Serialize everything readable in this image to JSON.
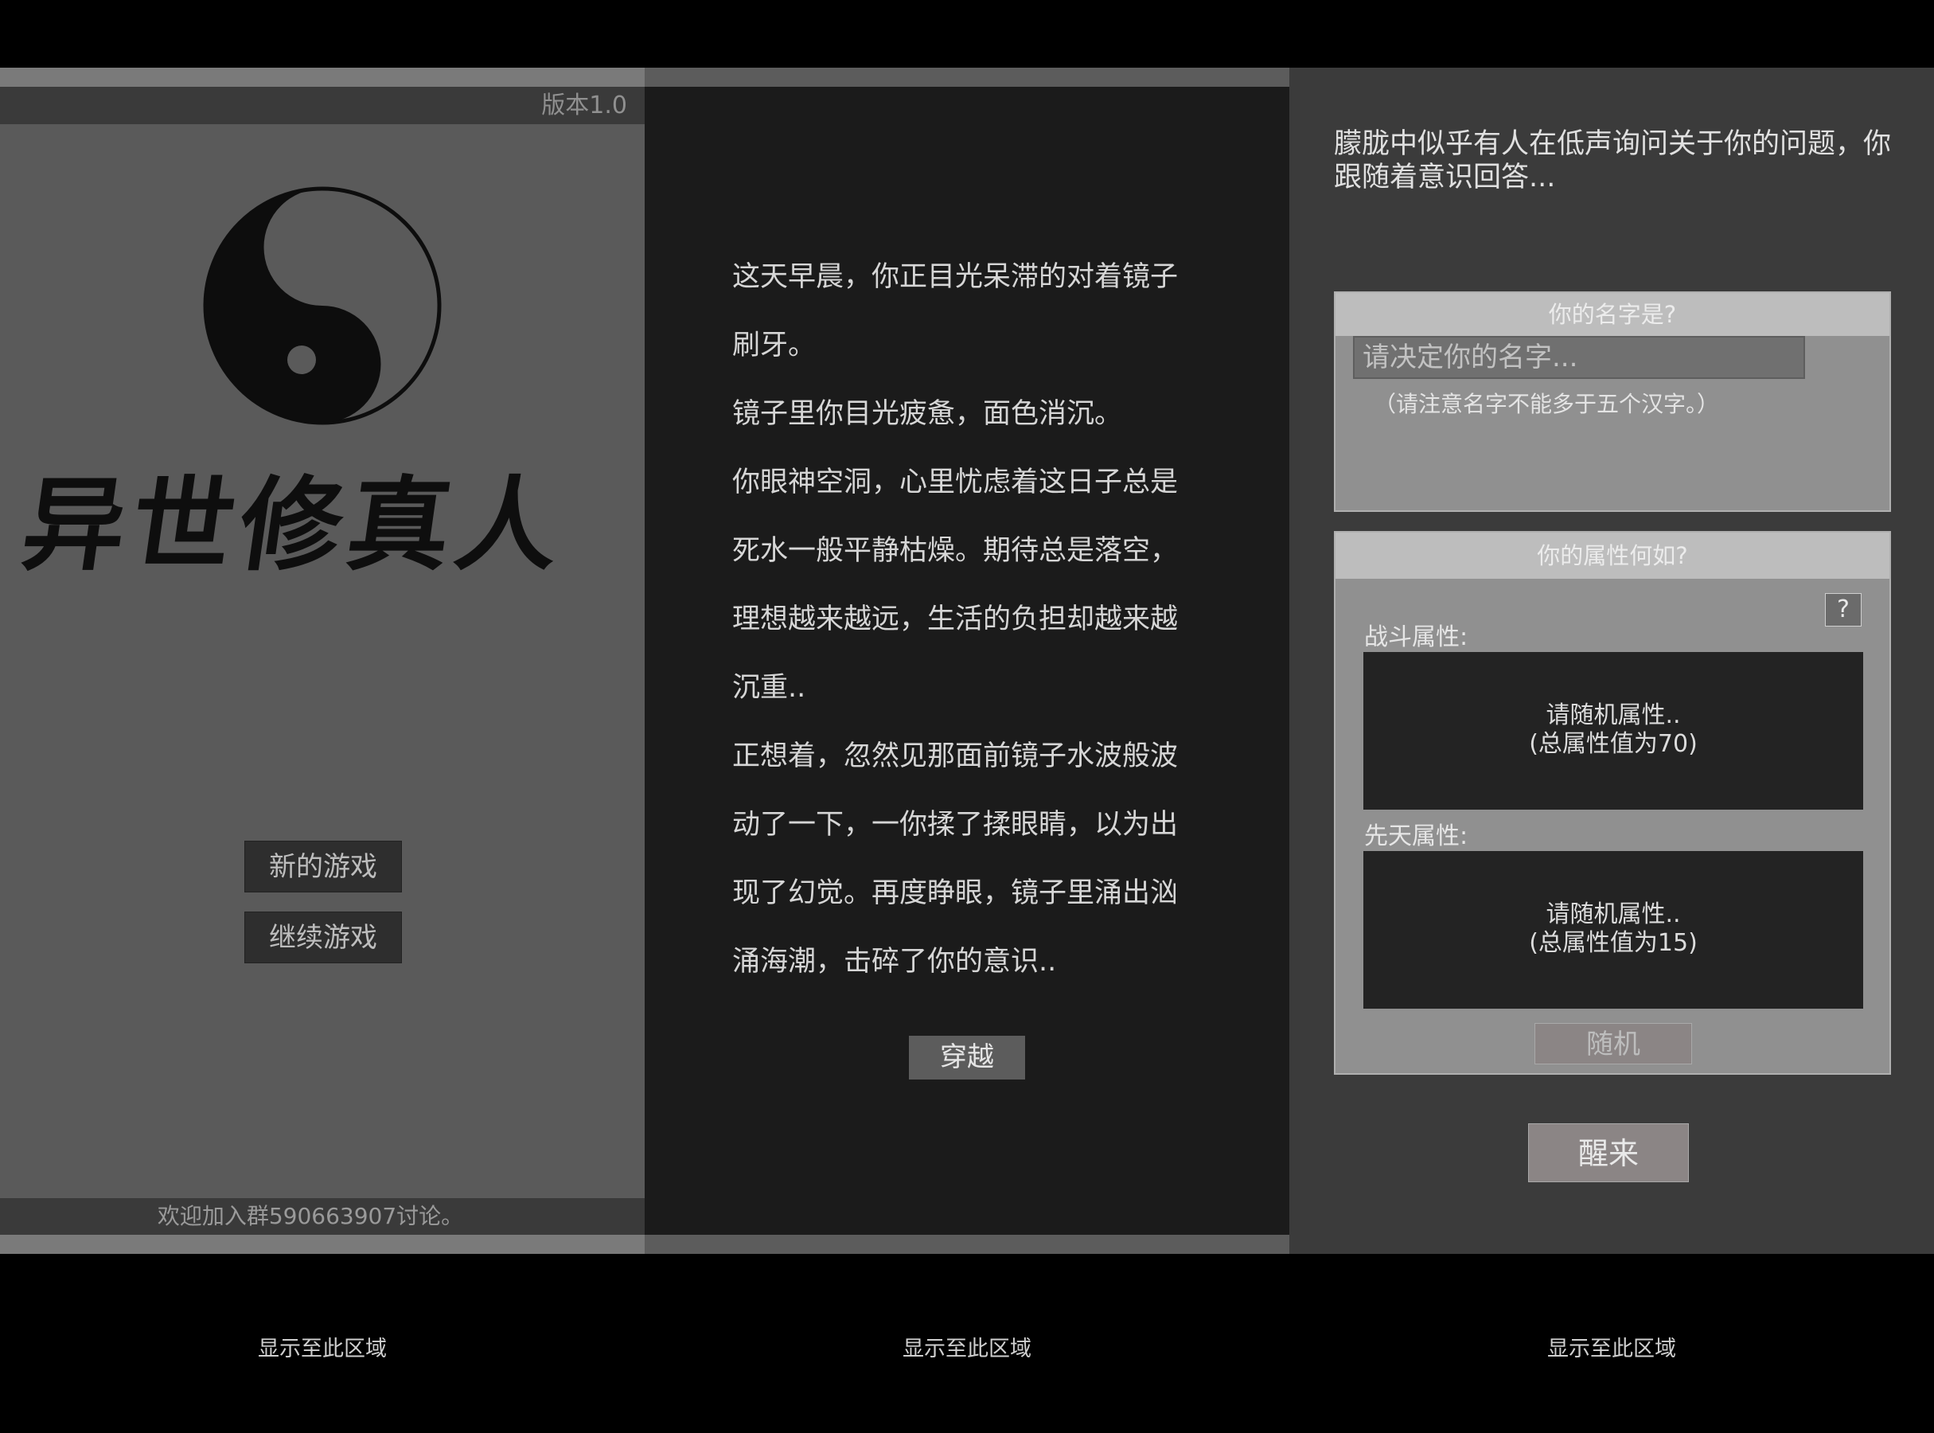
{
  "title_screen": {
    "version": "版本1.0",
    "calligraphy_title": "异世修真人",
    "new_game_label": "新的游戏",
    "continue_game_label": "继续游戏",
    "footer": "欢迎加入群590663907讨论。"
  },
  "story_screen": {
    "paragraphs": [
      "这天早晨，你正目光呆滞的对着镜子刷牙。",
      "镜子里你目光疲惫，面色消沉。",
      "你眼神空洞，心里忧虑着这日子总是死水一般平静枯燥。期待总是落空，理想越来越远，生活的负担却越来越沉重..",
      "正想着，忽然见那面前镜子水波般波动了一下，一你揉了揉眼睛，以为出现了幻觉。再度睁眼，镜子里涌出汹涌海潮，击碎了你的意识.."
    ],
    "cross_button_label": "穿越"
  },
  "creation_screen": {
    "intro": "朦胧中似乎有人在低声询问关于你的问题，你跟随着意识回答...",
    "name_card": {
      "header": "你的名字是?",
      "input_placeholder": "请决定你的名字...",
      "input_value": "",
      "note": "（请注意名字不能多于五个汉字。）"
    },
    "attr_card": {
      "header": "你的属性何如?",
      "help_label": "?",
      "combat_label": "战斗属性:",
      "combat_text_line1": "请随机属性..",
      "combat_text_line2": "(总属性值为70)",
      "innate_label": "先天属性:",
      "innate_text_line1": "请随机属性..",
      "innate_text_line2": "(总属性值为15)",
      "random_button_label": "随机"
    },
    "wake_button_label": "醒来"
  },
  "captions": [
    "显示至此区域",
    "显示至此区域",
    "显示至此区域"
  ]
}
